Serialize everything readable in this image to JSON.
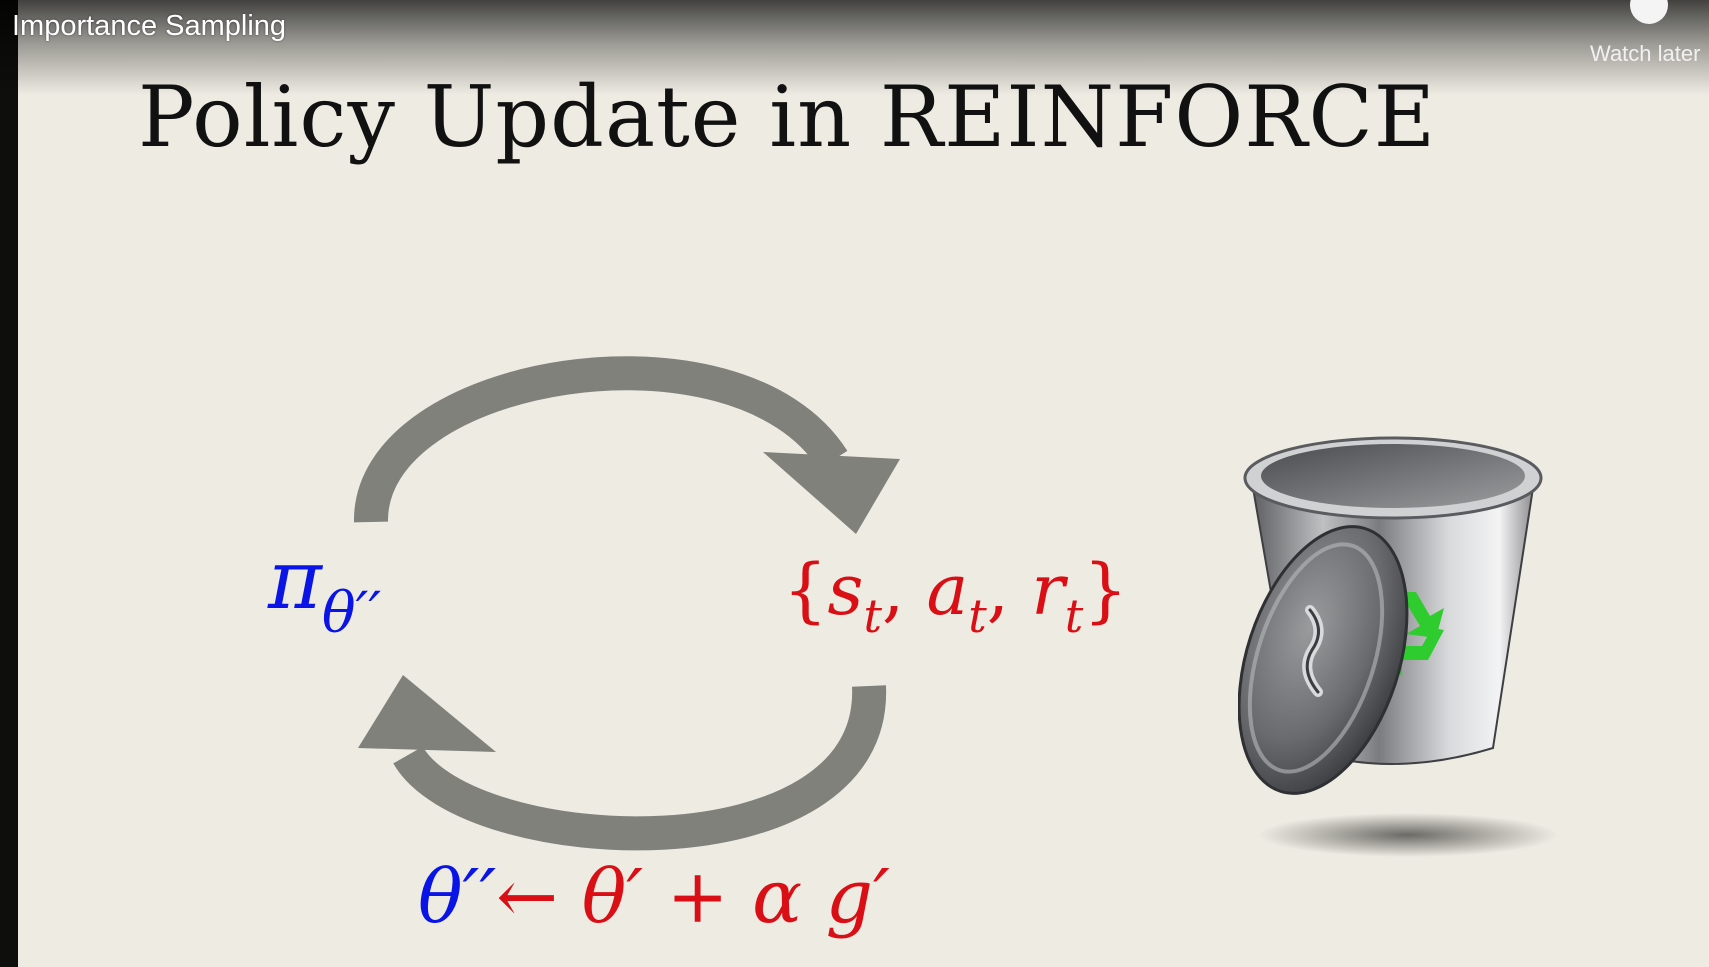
{
  "video": {
    "title": "Importance Sampling",
    "watch_later_label": "Watch later"
  },
  "slide": {
    "title": "Policy Update in REINFORCE",
    "policy": {
      "symbol": "π",
      "subscript": "θ′′"
    },
    "trajectory": {
      "open": "{",
      "s": "s",
      "s_sub": "t",
      "a": "a",
      "a_sub": "t",
      "r": "r",
      "r_sub": "t",
      "comma": ",",
      "close": "}"
    },
    "update_rule": {
      "lhs": "θ′′",
      "arrow": "←",
      "theta_prime": "θ′",
      "plus": "+",
      "alpha": "α",
      "g_prime": "g′"
    },
    "icons": {
      "cycle": "cycle-arrows-icon",
      "trash": "trash-can-icon",
      "recycle": "recycle-icon",
      "clock": "clock-icon"
    },
    "colors": {
      "background": "#edebe2",
      "policy": "#0a14e6",
      "data": "#d90f15",
      "arrow": "#80817b",
      "recycle": "#2ecc2e"
    }
  }
}
